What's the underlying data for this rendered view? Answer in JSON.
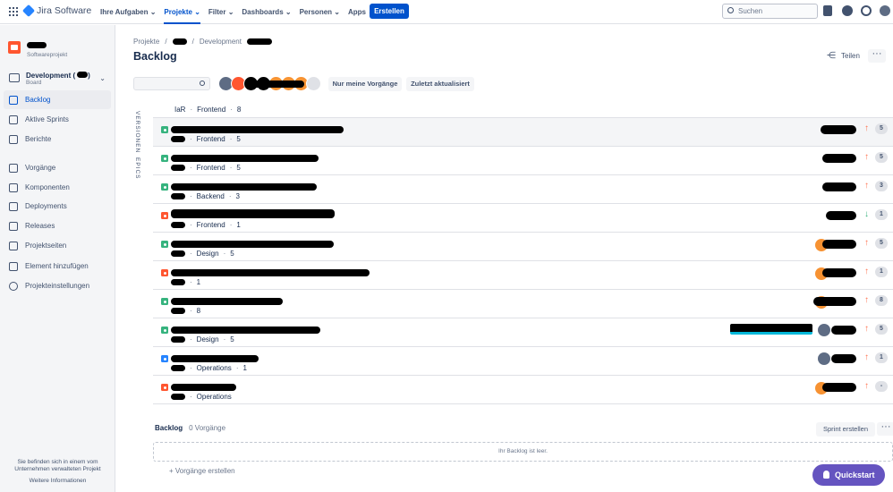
{
  "topbar": {
    "product": "Jira Software",
    "nav": [
      {
        "label": "Ihre Aufgaben ⌄",
        "active": false
      },
      {
        "label": "Projekte ⌄",
        "active": true
      },
      {
        "label": "Filter ⌄",
        "active": false
      },
      {
        "label": "Dashboards ⌄",
        "active": false
      },
      {
        "label": "Personen ⌄",
        "active": false
      },
      {
        "label": "Apps ⌄",
        "active": false
      }
    ],
    "create_label": "Erstellen",
    "search_placeholder": "Suchen"
  },
  "sidebar": {
    "project_type": "Softwareprojekt",
    "board_title": "Development (",
    "board_sub": "Board",
    "items": [
      {
        "label": "Backlog",
        "icon": "backlog-icon",
        "active": true
      },
      {
        "label": "Aktive Sprints",
        "icon": "sprints-icon",
        "active": false
      },
      {
        "label": "Berichte",
        "icon": "reports-icon",
        "active": false
      },
      {
        "label": "Vorgänge",
        "icon": "issues-icon",
        "active": false
      },
      {
        "label": "Komponenten",
        "icon": "components-icon",
        "active": false
      },
      {
        "label": "Deployments",
        "icon": "deployments-icon",
        "active": false
      },
      {
        "label": "Releases",
        "icon": "releases-icon",
        "active": false
      },
      {
        "label": "Projektseiten",
        "icon": "pages-icon",
        "active": false
      },
      {
        "label": "Element hinzufügen",
        "icon": "add-item-icon",
        "active": false
      },
      {
        "label": "Projekteinstellungen",
        "icon": "settings-icon",
        "active": false
      }
    ],
    "footer_line1": "Sie befinden sich in einem vom",
    "footer_line2": "Unternehmen verwalteten Projekt",
    "footer_link": "Weitere Informationen"
  },
  "main": {
    "breadcrumb": [
      "Projekte",
      "/",
      "/",
      "Development"
    ],
    "title": "Backlog",
    "share_label": "Teilen",
    "more_label": "···",
    "filters": [
      "Nur meine Vorgänge",
      "Zuletzt aktualisiert"
    ],
    "side_tabs": [
      "VERSIONEN",
      "EPICS"
    ],
    "first_row": {
      "key": "IaR",
      "component": "Frontend",
      "points": "8"
    },
    "issues": [
      {
        "type": "story",
        "component": "Frontend",
        "points": "5",
        "prio": "up",
        "estimate": "5"
      },
      {
        "type": "story",
        "component": "Frontend",
        "points": "5",
        "prio": "up",
        "estimate": "5"
      },
      {
        "type": "story",
        "component": "Backend",
        "points": "3",
        "prio": "up",
        "estimate": "3"
      },
      {
        "type": "bug",
        "component": "Frontend",
        "points": "1",
        "prio": "down",
        "estimate": "1"
      },
      {
        "type": "story",
        "component": "Design",
        "points": "5",
        "prio": "up",
        "estimate": "5"
      },
      {
        "type": "bug",
        "component": "",
        "points": "1",
        "prio": "up",
        "estimate": "1"
      },
      {
        "type": "story",
        "component": "",
        "points": "8",
        "prio": "up",
        "estimate": "8"
      },
      {
        "type": "story",
        "component": "Design",
        "points": "5",
        "prio": "up",
        "estimate": "5"
      },
      {
        "type": "task",
        "component": "Operations",
        "points": "1",
        "prio": "up",
        "estimate": "1"
      },
      {
        "type": "bug",
        "component": "Operations",
        "points": "",
        "prio": "up",
        "estimate": "-"
      }
    ],
    "backlog": {
      "title": "Backlog",
      "count": "0 Vorgänge",
      "empty": "Ihr Backlog ist leer.",
      "create": "+ Vorgänge erstellen",
      "sprint_btn": "Sprint erstellen"
    },
    "quickstart": "Quickstart"
  },
  "colors": {
    "accent": "#0052cc",
    "story": "#36b37e",
    "bug": "#ff5630",
    "task": "#2684ff",
    "quickstart": "#6554c0"
  }
}
